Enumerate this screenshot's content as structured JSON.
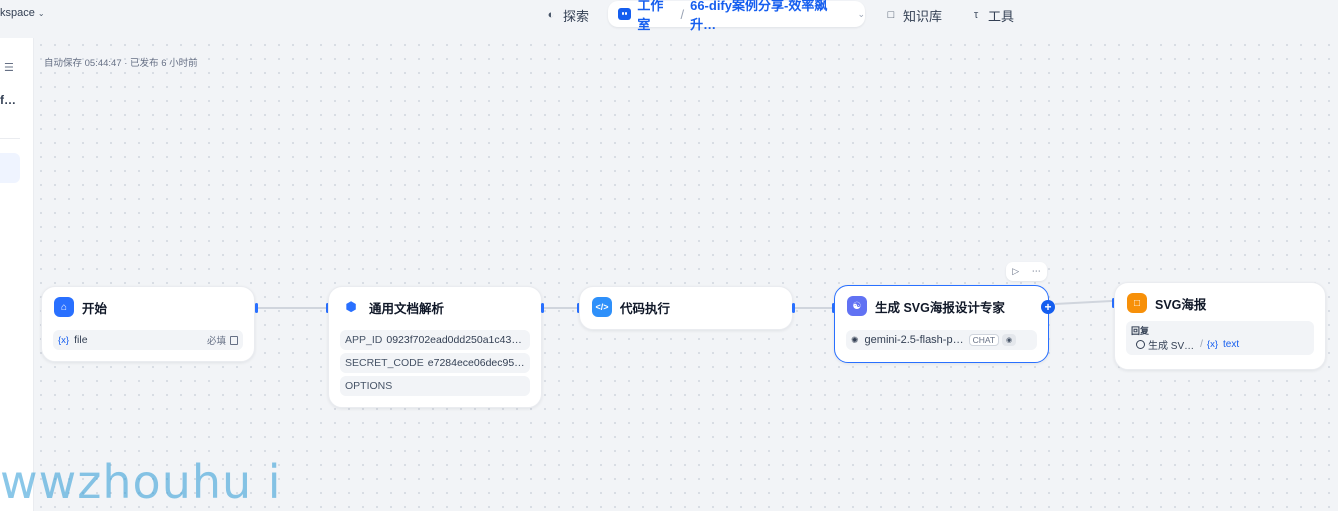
{
  "topbar": {
    "workspace": "kspace",
    "explore": "探索",
    "studio": "工作室",
    "app_name": "66-dify案例分享-效率飙升…",
    "knowledge": "知识库",
    "tools": "工具"
  },
  "sidebar": {
    "title": "f…"
  },
  "canvas": {
    "autosave": "自动保存 05:44:47 · 已发布 6 小时前"
  },
  "nodes": {
    "start": {
      "title": "开始",
      "var_icon": "{x}",
      "var_name": "file",
      "required": "必填"
    },
    "doc_parse": {
      "title": "通用文档解析",
      "rows": [
        {
          "key": "APP_ID",
          "value": "0923f702ead0dd250a1c43…"
        },
        {
          "key": "SECRET_CODE",
          "value": "e7284ece06dec95…"
        },
        {
          "key": "OPTIONS",
          "value": ""
        }
      ]
    },
    "code": {
      "title": "代码执行"
    },
    "llm": {
      "title": "生成 SVG海报设计专家",
      "model": "gemini-2.5-flash-p…",
      "mode": "CHAT"
    },
    "answer": {
      "title": "SVG海报",
      "reply_label": "回复",
      "source": "生成 SV…",
      "var_icon": "{x}",
      "var": "text"
    }
  },
  "watermark": "wwzhouhu i",
  "colors": {
    "accent": "#155eef",
    "start": "#2970ff",
    "tool": "#2970ff",
    "code": "#2e90fa",
    "llm": "#6172f3",
    "answer": "#f79009"
  }
}
